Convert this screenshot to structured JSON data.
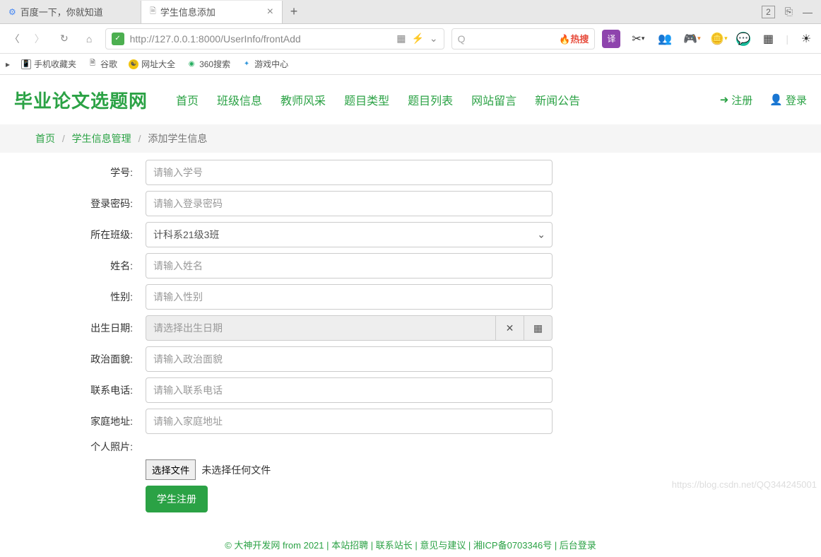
{
  "browser": {
    "tabs": [
      {
        "title": "百度一下，你就知道"
      },
      {
        "title": "学生信息添加"
      }
    ],
    "url": "http://127.0.0.1:8000/UserInfo/frontAdd",
    "right_badge": "2",
    "search_label": "热搜",
    "search_magnifier_label": "Q"
  },
  "bookmarks": [
    {
      "label": "手机收藏夹"
    },
    {
      "label": "谷歌"
    },
    {
      "label": "网址大全"
    },
    {
      "label": "360搜索"
    },
    {
      "label": "游戏中心"
    }
  ],
  "site": {
    "logo": "毕业论文选题网",
    "nav": [
      "首页",
      "班级信息",
      "教师风采",
      "题目类型",
      "题目列表",
      "网站留言",
      "新闻公告"
    ],
    "register": "注册",
    "login": "登录"
  },
  "breadcrumb": {
    "home": "首页",
    "mgmt": "学生信息管理",
    "current": "添加学生信息"
  },
  "form": {
    "labels": {
      "student_no": "学号:",
      "password": "登录密码:",
      "class": "所在班级:",
      "name": "姓名:",
      "gender": "性别:",
      "birthdate": "出生日期:",
      "political": "政治面貌:",
      "phone": "联系电话:",
      "address": "家庭地址:",
      "photo": "个人照片:"
    },
    "placeholders": {
      "student_no": "请输入学号",
      "password": "请输入登录密码",
      "name": "请输入姓名",
      "gender": "请输入性别",
      "birthdate": "请选择出生日期",
      "political": "请输入政治面貌",
      "phone": "请输入联系电话",
      "address": "请输入家庭地址"
    },
    "class_selected": "计科系21级3班",
    "file_btn": "选择文件",
    "file_none": "未选择任何文件",
    "submit": "学生注册"
  },
  "footer": "© 大神开发网 from 2021 | 本站招聘 | 联系站长 | 意见与建议 | 湘ICP备0703346号 | 后台登录",
  "watermark": "https://blog.csdn.net/QQ344245001"
}
